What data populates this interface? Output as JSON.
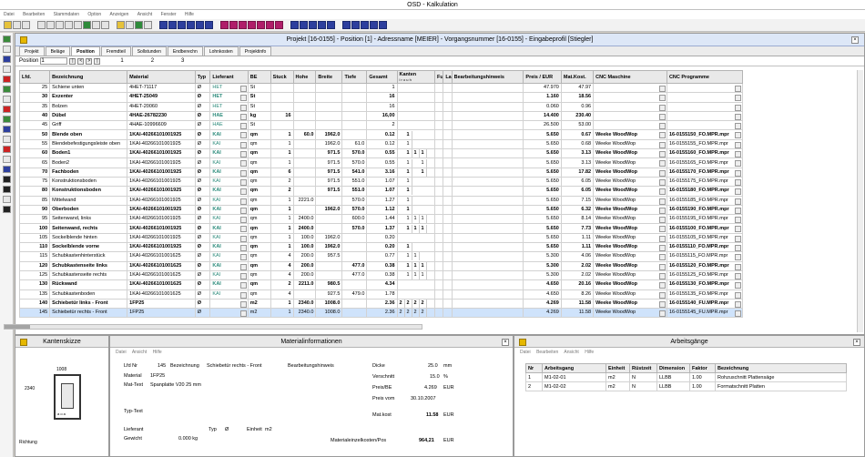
{
  "window": {
    "title": "OSD - Kalkulation"
  },
  "menu": [
    "Datei",
    "Bearbeiten",
    "Stammdaten",
    "Option",
    "Anzeigen",
    "Ansicht",
    "Fenster",
    "Hilfe"
  ],
  "project": {
    "title": "Projekt [16-0155] - Position [1] - Adressname [MEIER] - Vorgangsnummer [16-0155] - Eingabeprofil [Stiegler]",
    "tabs": [
      "Projekt",
      "Beläge",
      "Position",
      "Fremdteil",
      "Sollstunden",
      "Endberechn",
      "Lohnkosten",
      "Projektinfo"
    ],
    "active_tab": "Position",
    "pos_label": "Position",
    "pos_value": "1",
    "pos_nums": [
      "1",
      "2",
      "3"
    ]
  },
  "grid": {
    "headers": [
      "Lfd.",
      "Bezeichnung",
      "Material",
      "Typ",
      "Lieferant",
      "BE",
      "Stuck",
      "Hohe",
      "Breite",
      "Tiefe",
      "Gesamt",
      "Kanten",
      "Fu",
      "La",
      "Bearbeitungshinweis",
      "Preis / EUR",
      "Mat.Kost.",
      "CNC Maschine",
      "CNC Programme"
    ],
    "kanten_sub": "l r o u h",
    "rows": [
      {
        "lfd": "25",
        "bez": "Schiene unten",
        "mat": "4HET-71117",
        "typ": "Ø",
        "lief": "HET",
        "be": "St",
        "st": "",
        "h": "",
        "b": "",
        "t": "",
        "ges": "1",
        "k": [
          "",
          "",
          "",
          "",
          ""
        ],
        "preis": "47.970",
        "mk": "47.97",
        "cnc": "",
        "prog": "",
        "bold": false
      },
      {
        "lfd": "30",
        "bez": "Exzenter",
        "mat": "4HET-25049",
        "typ": "Ø",
        "lief": "HET",
        "be": "St",
        "st": "",
        "h": "",
        "b": "",
        "t": "",
        "ges": "16",
        "k": [
          "",
          "",
          "",
          "",
          ""
        ],
        "preis": "1.160",
        "mk": "18.56",
        "cnc": "",
        "prog": "",
        "bold": true
      },
      {
        "lfd": "35",
        "bez": "Bolzen",
        "mat": "4HET-20060",
        "typ": "Ø",
        "lief": "HET",
        "be": "St",
        "st": "",
        "h": "",
        "b": "",
        "t": "",
        "ges": "16",
        "k": [
          "",
          "",
          "",
          "",
          ""
        ],
        "preis": "0.060",
        "mk": "0.96",
        "cnc": "",
        "prog": "",
        "bold": false
      },
      {
        "lfd": "40",
        "bez": "Dübel",
        "mat": "4HAE-26782230",
        "typ": "Ø",
        "lief": "HAE",
        "be": "kg",
        "st": "16",
        "h": "",
        "b": "",
        "t": "",
        "ges": "16,00",
        "k": [
          "",
          "",
          "",
          "",
          ""
        ],
        "preis": "14.400",
        "mk": "230.40",
        "cnc": "",
        "prog": "",
        "bold": true
      },
      {
        "lfd": "45",
        "bez": "Griff",
        "mat": "4HAE-10996609",
        "typ": "Ø",
        "lief": "HAE",
        "be": "St",
        "st": "",
        "h": "",
        "b": "",
        "t": "",
        "ges": "2",
        "k": [
          "",
          "",
          "",
          "",
          ""
        ],
        "preis": "26.500",
        "mk": "53.00",
        "cnc": "",
        "prog": "",
        "bold": false
      },
      {
        "lfd": "50",
        "bez": "Blende oben",
        "mat": "1KAI-40266101001925",
        "typ": "Ø",
        "lief": "KAI",
        "be": "qm",
        "st": "1",
        "h": "60.0",
        "b": "1962.0",
        "t": "",
        "ges": "0.12",
        "k": [
          "",
          "1",
          "",
          "",
          ""
        ],
        "preis": "5.650",
        "mk": "0.67",
        "cnc": "Weeke WoodWop",
        "prog": "16-0155150_FO.MPR.mpr",
        "bold": true
      },
      {
        "lfd": "55",
        "bez": "Blendebefestigungsleiste oben",
        "mat": "1KAI-40266101001925",
        "typ": "Ø",
        "lief": "KAI",
        "be": "qm",
        "st": "1",
        "h": "",
        "b": "1962.0",
        "t": "61.0",
        "ges": "0.12",
        "k": [
          "",
          "1",
          "",
          "",
          ""
        ],
        "preis": "5.650",
        "mk": "0.68",
        "cnc": "Weeke WoodWop",
        "prog": "16-0155155_FO.MPR.mpr",
        "bold": false
      },
      {
        "lfd": "60",
        "bez": "Boden1",
        "mat": "1KAI-40266101001925",
        "typ": "Ø",
        "lief": "KAI",
        "be": "qm",
        "st": "1",
        "h": "",
        "b": "971.5",
        "t": "570.0",
        "ges": "0.55",
        "k": [
          "",
          "1",
          "1",
          "1",
          ""
        ],
        "preis": "5.650",
        "mk": "3.13",
        "cnc": "Weeke WoodWop",
        "prog": "16-0155160_FO.MPR.mpr",
        "bold": true
      },
      {
        "lfd": "65",
        "bez": "Boden2",
        "mat": "1KAI-40266101001925",
        "typ": "Ø",
        "lief": "KAI",
        "be": "qm",
        "st": "1",
        "h": "",
        "b": "971.5",
        "t": "570.0",
        "ges": "0.55",
        "k": [
          "",
          "1",
          "",
          "1",
          ""
        ],
        "preis": "5.650",
        "mk": "3.13",
        "cnc": "Weeke WoodWop",
        "prog": "16-0155165_FO.MPR.mpr",
        "bold": false
      },
      {
        "lfd": "70",
        "bez": "Fachboden",
        "mat": "1KAI-40266101001925",
        "typ": "Ø",
        "lief": "KAI",
        "be": "qm",
        "st": "6",
        "h": "",
        "b": "971.5",
        "t": "541.0",
        "ges": "3.16",
        "k": [
          "",
          "1",
          "",
          "1",
          ""
        ],
        "preis": "5.650",
        "mk": "17.82",
        "cnc": "Weeke WoodWop",
        "prog": "16-0155170_FO.MPR.mpr",
        "bold": true
      },
      {
        "lfd": "75",
        "bez": "Konstruktionsboden",
        "mat": "1KAI-40266101001925",
        "typ": "Ø",
        "lief": "KAI",
        "be": "qm",
        "st": "2",
        "h": "",
        "b": "971.5",
        "t": "551.0",
        "ges": "1.07",
        "k": [
          "",
          "1",
          "",
          "",
          ""
        ],
        "preis": "5.650",
        "mk": "6.05",
        "cnc": "Weeke WoodWop",
        "prog": "16-0155175_FO.MPR.mpr",
        "bold": false
      },
      {
        "lfd": "80",
        "bez": "Konstruktionsboden",
        "mat": "1KAI-40266101001925",
        "typ": "Ø",
        "lief": "KAI",
        "be": "qm",
        "st": "2",
        "h": "",
        "b": "971.5",
        "t": "551.0",
        "ges": "1.07",
        "k": [
          "",
          "1",
          "",
          "",
          ""
        ],
        "preis": "5.650",
        "mk": "6.05",
        "cnc": "Weeke WoodWop",
        "prog": "16-0155180_FO.MPR.mpr",
        "bold": true
      },
      {
        "lfd": "85",
        "bez": "Mittelwand",
        "mat": "1KAI-40266101001925",
        "typ": "Ø",
        "lief": "KAI",
        "be": "qm",
        "st": "1",
        "h": "2221.0",
        "b": "",
        "t": "570.0",
        "ges": "1.27",
        "k": [
          "",
          "1",
          "",
          "",
          ""
        ],
        "preis": "5.650",
        "mk": "7.15",
        "cnc": "Weeke WoodWop",
        "prog": "16-0155185_FO.MPR.mpr",
        "bold": false
      },
      {
        "lfd": "90",
        "bez": "Oberboden",
        "mat": "1KAI-40266101001925",
        "typ": "Ø",
        "lief": "KAI",
        "be": "qm",
        "st": "1",
        "h": "",
        "b": "1962.0",
        "t": "570.0",
        "ges": "1.12",
        "k": [
          "",
          "1",
          "",
          "",
          ""
        ],
        "preis": "5.650",
        "mk": "6.32",
        "cnc": "Weeke WoodWop",
        "prog": "16-0155190_FO.MPR.mpr",
        "bold": true
      },
      {
        "lfd": "95",
        "bez": "Seitenwand, links",
        "mat": "1KAI-40266101001925",
        "typ": "Ø",
        "lief": "KAI",
        "be": "qm",
        "st": "1",
        "h": "2400.0",
        "b": "",
        "t": "600.0",
        "ges": "1.44",
        "k": [
          "",
          "1",
          "1",
          "1",
          ""
        ],
        "preis": "5.650",
        "mk": "8.14",
        "cnc": "Weeke WoodWop",
        "prog": "16-0155195_FO.MPR.mpr",
        "bold": false
      },
      {
        "lfd": "100",
        "bez": "Seitenwand, rechts",
        "mat": "1KAI-40266101001925",
        "typ": "Ø",
        "lief": "KAI",
        "be": "qm",
        "st": "1",
        "h": "2400.0",
        "b": "",
        "t": "570.0",
        "ges": "1.37",
        "k": [
          "",
          "1",
          "1",
          "1",
          ""
        ],
        "preis": "5.650",
        "mk": "7.73",
        "cnc": "Weeke WoodWop",
        "prog": "16-0155100_FO.MPR.mpr",
        "bold": true
      },
      {
        "lfd": "105",
        "bez": "Sockelblende hinten",
        "mat": "1KAI-40266101001925",
        "typ": "Ø",
        "lief": "KAI",
        "be": "qm",
        "st": "1",
        "h": "100.0",
        "b": "1962.0",
        "t": "",
        "ges": "0.20",
        "k": [
          "",
          "",
          "",
          "",
          ""
        ],
        "preis": "5.650",
        "mk": "1.11",
        "cnc": "Weeke WoodWop",
        "prog": "16-0155105_FO.MPR.mpr",
        "bold": false
      },
      {
        "lfd": "110",
        "bez": "Sockelblende vorne",
        "mat": "1KAI-40266101001925",
        "typ": "Ø",
        "lief": "KAI",
        "be": "qm",
        "st": "1",
        "h": "100.0",
        "b": "1962.0",
        "t": "",
        "ges": "0.20",
        "k": [
          "",
          "1",
          "",
          "",
          ""
        ],
        "preis": "5.650",
        "mk": "1.11",
        "cnc": "Weeke WoodWop",
        "prog": "16-0155110_FO.MPR.mpr",
        "bold": true
      },
      {
        "lfd": "115",
        "bez": "Schubkastenhinterstück",
        "mat": "1KAI-40266101001625",
        "typ": "Ø",
        "lief": "KAI",
        "be": "qm",
        "st": "4",
        "h": "200.0",
        "b": "957.5",
        "t": "",
        "ges": "0.77",
        "k": [
          "",
          "1",
          "1",
          "",
          ""
        ],
        "preis": "5.300",
        "mk": "4.06",
        "cnc": "Weeke WoodWop",
        "prog": "16-0155115_FO.MPR.mpr",
        "bold": false
      },
      {
        "lfd": "120",
        "bez": "Schubkastenseite links",
        "mat": "1KAI-40266101001625",
        "typ": "Ø",
        "lief": "KAI",
        "be": "qm",
        "st": "4",
        "h": "200.0",
        "b": "",
        "t": "477.0",
        "ges": "0.38",
        "k": [
          "",
          "1",
          "1",
          "1",
          ""
        ],
        "preis": "5.300",
        "mk": "2.02",
        "cnc": "Weeke WoodWop",
        "prog": "16-0155120_FO.MPR.mpr",
        "bold": true
      },
      {
        "lfd": "125",
        "bez": "Schubkastenseite rechts",
        "mat": "1KAI-40266101001625",
        "typ": "Ø",
        "lief": "KAI",
        "be": "qm",
        "st": "4",
        "h": "200.0",
        "b": "",
        "t": "477.0",
        "ges": "0.38",
        "k": [
          "",
          "1",
          "1",
          "1",
          ""
        ],
        "preis": "5.300",
        "mk": "2.02",
        "cnc": "Weeke WoodWop",
        "prog": "16-0155125_FO.MPR.mpr",
        "bold": false
      },
      {
        "lfd": "130",
        "bez": "Rückwand",
        "mat": "1KAI-40266101001625",
        "typ": "Ø",
        "lief": "KAI",
        "be": "qm",
        "st": "2",
        "h": "2211.0",
        "b": "980.5",
        "t": "",
        "ges": "4.34",
        "k": [
          "",
          "",
          "",
          "",
          ""
        ],
        "preis": "4.650",
        "mk": "20.16",
        "cnc": "Weeke WoodWop",
        "prog": "16-0155130_FO.MPR.mpr",
        "bold": true
      },
      {
        "lfd": "135",
        "bez": "Schubkastenboden",
        "mat": "1KAI-40266101001625",
        "typ": "Ø",
        "lief": "KAI",
        "be": "qm",
        "st": "4",
        "h": "",
        "b": "927.5",
        "t": "479.0",
        "ges": "1.78",
        "k": [
          "",
          "",
          "",
          "",
          ""
        ],
        "preis": "4.650",
        "mk": "8.26",
        "cnc": "Weeke WoodWop",
        "prog": "16-0155135_FO.MPR.mpr",
        "bold": false
      },
      {
        "lfd": "140",
        "bez": "Schiebetür links - Front",
        "mat": "1FP25",
        "typ": "Ø",
        "lief": "",
        "be": "m2",
        "st": "1",
        "h": "2340.0",
        "b": "1008.0",
        "t": "",
        "ges": "2.36",
        "k": [
          "2",
          "2",
          "2",
          "2",
          ""
        ],
        "preis": "4.269",
        "mk": "11.58",
        "cnc": "Weeke WoodWop",
        "prog": "16-0155140_FU.MPR.mpr",
        "bold": true
      },
      {
        "lfd": "145",
        "bez": "Schiebetür rechts - Front",
        "mat": "1FP25",
        "typ": "Ø",
        "lief": "",
        "be": "m2",
        "st": "1",
        "h": "2340.0",
        "b": "1008.0",
        "t": "",
        "ges": "2.36",
        "k": [
          "2",
          "2",
          "2",
          "2",
          ""
        ],
        "preis": "4.269",
        "mk": "11.58",
        "cnc": "Weeke WoodWop",
        "prog": "16-0155145_FU.MPR.mpr",
        "bold": false,
        "selected": true
      }
    ]
  },
  "kantenskizze": {
    "title": "Kantenskizze",
    "top": "1008",
    "left": "2340",
    "label": "Richtung",
    "inner": "a o a"
  },
  "materialinfo": {
    "title": "Materialinformationen",
    "menu": [
      "Datei",
      "Ansicht",
      "Hilfe"
    ],
    "lfd_label": "Lfd Nr",
    "lfd": "145",
    "bez_label": "Bezeichnung",
    "bez": "Schiebetür rechts - Front",
    "bearb_label": "Bearbeitungshinweis",
    "mat_label": "Material",
    "mat": "1FP25",
    "mattext_label": "Mat-Text",
    "mattext": "Spanplatte  V20  25 mm",
    "typtext_label": "Typ-Text",
    "lief_label": "Lieferant",
    "typ_label": "Typ",
    "typ": "Ø",
    "einheit_label": "Einheit",
    "einheit": "m2",
    "gewicht_label": "Gewicht",
    "gewicht": "0.000 kg",
    "dicke_label": "Dicke",
    "dicke": "25.0",
    "dicke_unit": "mm",
    "verschnitt_label": "Verschnitt",
    "verschnitt": "15.0",
    "verschnitt_unit": "%",
    "preis_label": "Preis/BE",
    "preis": "4.269",
    "preis_unit": "EUR",
    "preisvom_label": "Preis vom",
    "preisvom": "30.10.2007",
    "matkost_label": "Mat.kost",
    "matkost": "11.58",
    "matkost_unit": "EUR",
    "summe_label": "Materialeinzelkosten/Pos",
    "summe": "964,21",
    "summe_unit": "EUR"
  },
  "arbeitsgaenge": {
    "title": "Arbeitsgänge",
    "menu": [
      "Datei",
      "Bearbeiten",
      "Ansicht",
      "Hilfe"
    ],
    "headers": [
      "Nr",
      "Arbeitsgang",
      "Einheit",
      "Rüstzeit",
      "Dimension",
      "Faktor",
      "Bezeichnung"
    ],
    "rows": [
      {
        "nr": "1",
        "ag": "M1-02-01",
        "einheit": "m2",
        "ruest": "N",
        "dim": "LLBB",
        "faktor": "1.00",
        "bez": "Rohzuschnitt Plattensäge"
      },
      {
        "nr": "2",
        "ag": "M1-02-02",
        "einheit": "m2",
        "ruest": "N",
        "dim": "LLBB",
        "faktor": "1.00",
        "bez": "Formatschnitt Platten"
      }
    ]
  }
}
